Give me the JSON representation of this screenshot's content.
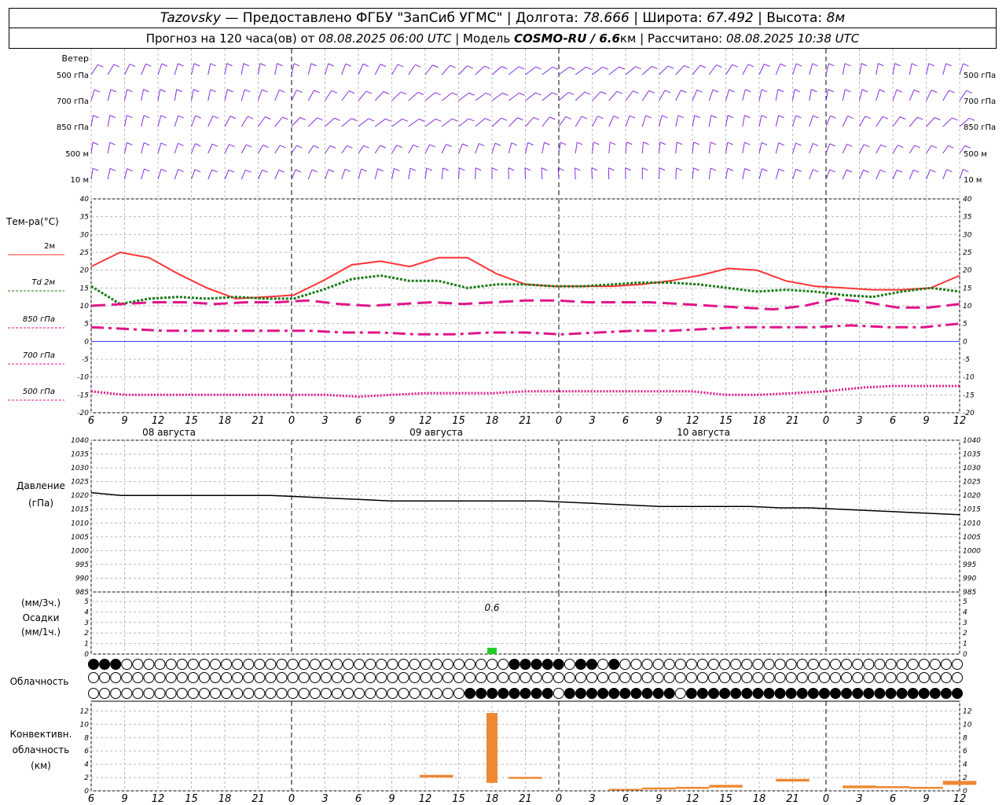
{
  "header": {
    "station": "Tazovsky",
    "provider": " — Предоставлено ФГБУ \"ЗапСиб УГМС\" | Долгота: ",
    "lon": "78.666",
    "lat_label": " | Широта: ",
    "lat": "67.492",
    "alt_label": " | Высота: ",
    "alt": "8м",
    "forecast_label": "Прогноз на 120 часа(ов) от ",
    "forecast_start": "08.08.2025 06:00 UTC",
    "model_label": " | Модель ",
    "model": "COSMO-RU / 6.6",
    "model_unit": "км",
    "calc_label": " | Рассчитано: ",
    "calc_time": "08.08.2025 10:38 UTC"
  },
  "colors": {
    "wind": "#8a2be2",
    "t2m": "#ff3333",
    "td2m": "#1a7a1a",
    "t850": "#e0158a",
    "t700": "#e0158a",
    "t500": "#e0158a",
    "zero_line": "#3333ff",
    "pressure": "#000000",
    "precip": "#22cc22",
    "convective": "#ee8833"
  },
  "wind_panel": {
    "title": "Ветер",
    "levels": [
      "500 гПа",
      "700 гПа",
      "850 гПа",
      "500 м",
      "10 м"
    ]
  },
  "temp_panel": {
    "title": "Тем-ра(°C)",
    "legend": [
      {
        "label": "2м",
        "style": "solid",
        "color_key": "t2m"
      },
      {
        "label": "Td  2м",
        "style": "dashed-fine",
        "color_key": "td2m"
      },
      {
        "label": "850 гПа",
        "style": "dashed-long",
        "color_key": "t850"
      },
      {
        "label": "700 гПа",
        "style": "dash-dot",
        "color_key": "t700"
      },
      {
        "label": "500 гПа",
        "style": "dotted",
        "color_key": "t500"
      }
    ],
    "yticks": [
      "40",
      "35",
      "30",
      "25",
      "20",
      "15",
      "10",
      "5",
      "0",
      "-5",
      "-10",
      "-15",
      "-20"
    ]
  },
  "time_axis": {
    "hour_labels": [
      "6",
      "9",
      "12",
      "15",
      "18",
      "21",
      "0",
      "3",
      "6",
      "9",
      "12",
      "15",
      "18",
      "21",
      "0",
      "3",
      "6",
      "9",
      "12",
      "15",
      "18",
      "21",
      "0",
      "3",
      "6",
      "9",
      "12"
    ],
    "dates": [
      "08 августа",
      "09 августа",
      "10 августа"
    ]
  },
  "pressure_panel": {
    "title": "Давление",
    "unit": "(гПа)",
    "yticks": [
      "1040",
      "1035",
      "1030",
      "1025",
      "1020",
      "1015",
      "1010",
      "1005",
      "1000",
      "995",
      "990",
      "985"
    ]
  },
  "precip_panel": {
    "unit_top": "(мм/3ч.)",
    "title": "Осадки",
    "unit_bottom": "(мм/1ч.)",
    "yticks": [
      "5",
      "4",
      "3",
      "2",
      "1",
      "0"
    ],
    "annotation": "0.6"
  },
  "cloud_panel": {
    "title": "Облачность"
  },
  "convective_panel": {
    "title_lines": [
      "Конвективн.",
      "облачность",
      "(км)"
    ],
    "yticks": [
      "12",
      "10",
      "8",
      "6",
      "4",
      "2",
      "0"
    ]
  },
  "chart_data": [
    {
      "type": "line",
      "title": "Тем-ра(°C)",
      "x_hours": [
        0,
        3,
        6,
        9,
        12,
        15,
        18,
        21,
        24,
        27,
        30,
        33,
        36,
        39,
        42,
        45,
        48,
        51,
        54,
        57,
        60,
        63,
        66,
        69,
        72,
        75,
        78
      ],
      "ylim": [
        -20,
        40
      ],
      "series": [
        {
          "name": "2м",
          "values": [
            21,
            25,
            23.5,
            19,
            15,
            12,
            12.5,
            13,
            17,
            21.5,
            22.5,
            21,
            23.5,
            23.5,
            19,
            16,
            15.5,
            15.5,
            15.5,
            16,
            17,
            18.5,
            20.5,
            20,
            17,
            15.5,
            15,
            14.5,
            14.5,
            15,
            18.5
          ]
        },
        {
          "name": "Td  2м",
          "values": [
            15.5,
            10.5,
            12,
            12.5,
            12,
            12.5,
            12,
            12,
            14.5,
            17.5,
            18.5,
            17,
            17,
            15,
            16,
            16,
            15.5,
            15.5,
            16,
            16.5,
            16.5,
            16,
            15,
            14,
            14.5,
            14,
            13,
            12.5,
            14,
            15,
            14
          ]
        },
        {
          "name": "850 гПа",
          "values": [
            10,
            10.5,
            11,
            11,
            10.5,
            11,
            11,
            11.5,
            10.5,
            10,
            10.5,
            11,
            10.5,
            11,
            11.5,
            11.5,
            11,
            11,
            11,
            10.5,
            10,
            9.5,
            9,
            10,
            12,
            11,
            9.5,
            9.5,
            10.5
          ]
        },
        {
          "name": "700 гПа",
          "values": [
            4,
            3.5,
            3,
            3,
            3,
            3,
            3,
            2.5,
            2.5,
            2,
            2,
            2.5,
            2.5,
            2,
            2.5,
            3,
            3,
            3.5,
            4,
            4,
            4,
            4.5,
            4,
            4,
            5
          ]
        },
        {
          "name": "500 гПа",
          "values": [
            -14,
            -15,
            -15,
            -15,
            -15,
            -15,
            -15,
            -15,
            -15.5,
            -15,
            -14.5,
            -14.5,
            -14.5,
            -14,
            -14,
            -14,
            -14,
            -14,
            -14,
            -15,
            -15,
            -14.5,
            -14,
            -13,
            -12.5,
            -12.5,
            -12.5
          ]
        }
      ]
    },
    {
      "type": "line",
      "title": "Давление",
      "ylim": [
        985,
        1040
      ],
      "series": [
        {
          "name": "Давление",
          "values": [
            1021,
            1020,
            1020,
            1020,
            1020,
            1020,
            1020,
            1019.5,
            1019,
            1018.5,
            1018,
            1018,
            1018,
            1018,
            1018,
            1018,
            1017.5,
            1017,
            1016.5,
            1016,
            1016,
            1016,
            1016,
            1015.5,
            1015.5,
            1015,
            1014.5,
            1014,
            1013.5,
            1013
          ]
        }
      ]
    },
    {
      "type": "bar",
      "title": "Осадки",
      "ylim": [
        0,
        5
      ],
      "bars": [
        {
          "x_hour": 36,
          "value": 0.6
        }
      ]
    },
    {
      "type": "bar",
      "title": "Конвективн. облачность (км)",
      "ylim": [
        0,
        13
      ],
      "bars": [
        {
          "x_hour": 31,
          "base": 2,
          "top": 2.4
        },
        {
          "x_hour": 36,
          "base": 1.2,
          "top": 11.7
        },
        {
          "x_hour": 39,
          "base": 1.8,
          "top": 2.1
        },
        {
          "x_hour": 48,
          "base": 0.1,
          "top": 0.3
        },
        {
          "x_hour": 51,
          "base": 0.2,
          "top": 0.5
        },
        {
          "x_hour": 54,
          "base": 0.3,
          "top": 0.6
        },
        {
          "x_hour": 57,
          "base": 0.5,
          "top": 0.9
        },
        {
          "x_hour": 63,
          "base": 1.4,
          "top": 1.8
        },
        {
          "x_hour": 69,
          "base": 0.4,
          "top": 0.8
        },
        {
          "x_hour": 72,
          "base": 0.4,
          "top": 0.7
        },
        {
          "x_hour": 75,
          "base": 0.3,
          "top": 0.6
        },
        {
          "x_hour": 78,
          "base": 0.9,
          "top": 1.5
        }
      ]
    }
  ]
}
